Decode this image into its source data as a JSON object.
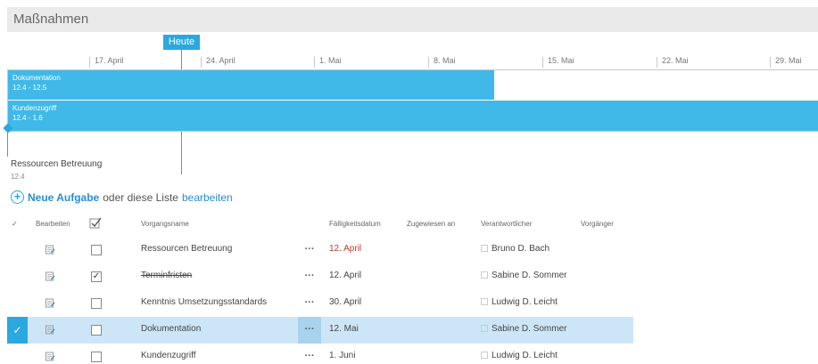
{
  "header": {
    "title": "Maßnahmen"
  },
  "timeline": {
    "today_label": "Heute",
    "ticks": [
      "17. April",
      "24. April",
      "1. Mai",
      "8. Mai",
      "15. Mai",
      "22. Mai",
      "29. Mai"
    ],
    "bars": [
      {
        "name": "Dokumentation",
        "range": "12.4 - 12.5"
      },
      {
        "name": "Kundenzugriff",
        "range": "12.4 - 1.6"
      }
    ],
    "milestone": {
      "name": "Ressourcen Betreuung",
      "date": "12.4"
    }
  },
  "actions": {
    "new_task": "Neue Aufgabe",
    "or_text": "oder diese Liste",
    "edit_link": "bearbeiten"
  },
  "columns": {
    "check": "✓",
    "edit": "Bearbeiten",
    "name": "Vorgangsname",
    "due": "Fälligkeitsdatum",
    "assigned": "Zugewiesen an",
    "owner": "Verantwortlicher",
    "predecessor": "Vorgänger"
  },
  "rows": [
    {
      "name": "Ressourcen Betreuung",
      "due": "12. April",
      "owner": "Bruno D. Bach",
      "done": false,
      "overdue": true
    },
    {
      "name": "Terminfristen",
      "due": "12. April",
      "owner": "Sabine D. Sommer",
      "done": true,
      "overdue": false
    },
    {
      "name": "Kenntnis Umsetzungsstandards",
      "due": "30. April",
      "owner": "Ludwig D. Leicht",
      "done": false,
      "overdue": false
    },
    {
      "name": "Dokumentation",
      "due": "12. Mai",
      "owner": "Sabine D. Sommer",
      "done": false,
      "overdue": false,
      "selected": true
    },
    {
      "name": "Kundenzugriff",
      "due": "1. Juni",
      "owner": "Ludwig D. Leicht",
      "done": false,
      "overdue": false
    }
  ],
  "row_ellipsis": "···",
  "selected_mark": "✓",
  "done_mark": "✓",
  "colors": {
    "accent": "#2aa8e0",
    "bar": "#40b9e8",
    "selected_row": "#cde6f7",
    "overdue": "#c0392b"
  }
}
